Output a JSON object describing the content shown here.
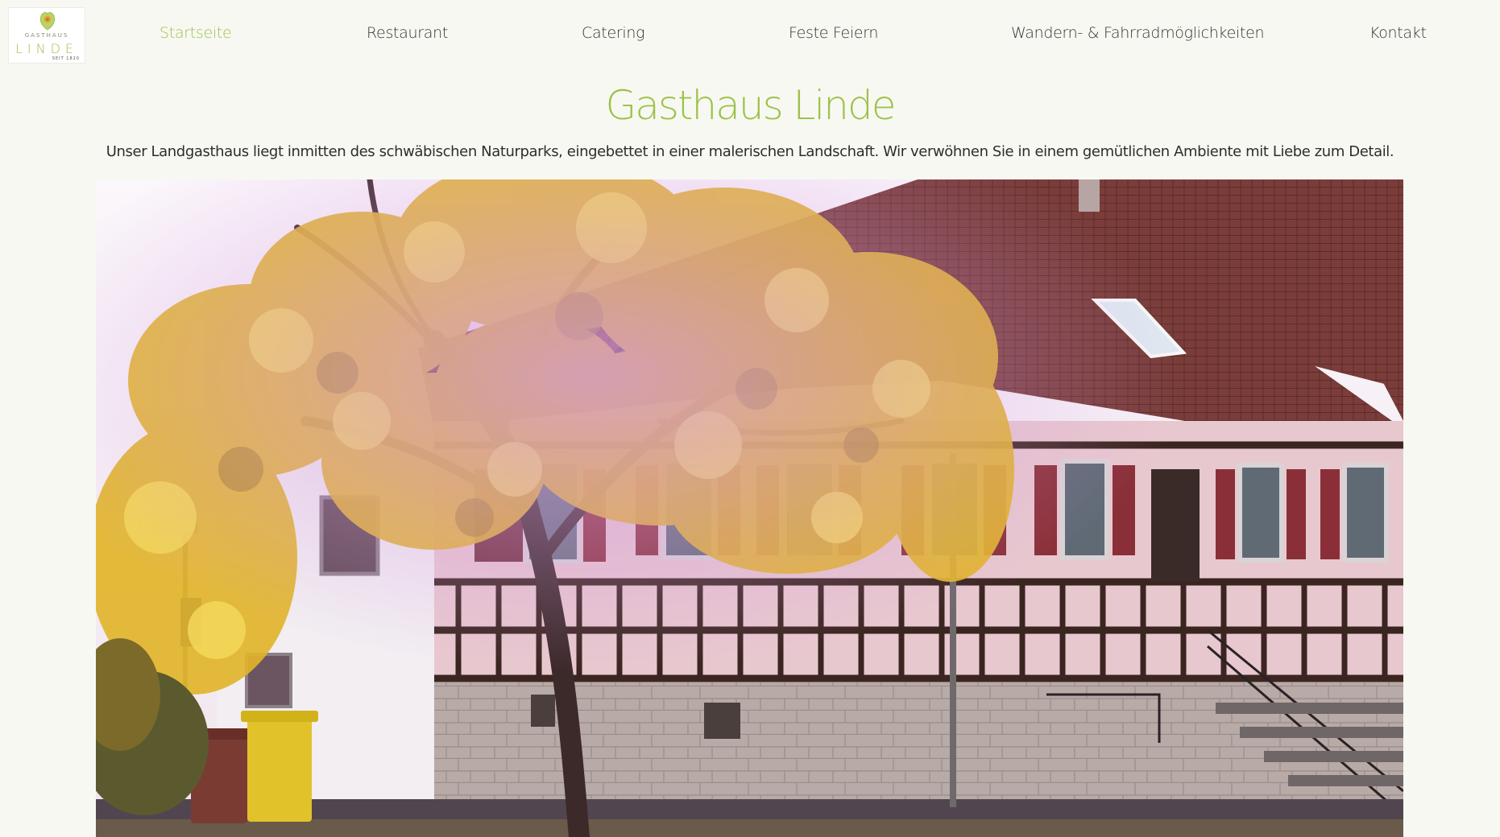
{
  "logo": {
    "top_text": "GASTHAUS",
    "main_text": "LINDE",
    "since_text": "SEIT 1820"
  },
  "nav": {
    "items": [
      {
        "label": "Startseite",
        "active": true
      },
      {
        "label": "Restaurant",
        "active": false
      },
      {
        "label": "Catering",
        "active": false
      },
      {
        "label": "Feste Feiern",
        "active": false
      },
      {
        "label": "Wandern- & Fahrradmöglichkeiten",
        "active": false
      },
      {
        "label": "Kontakt",
        "active": false
      }
    ]
  },
  "main": {
    "title": "Gasthaus Linde",
    "intro": "Unser Landgasthaus liegt inmitten des schwäbischen Naturparks, eingebettet in einer malerischen Landschaft. Wir verwöhnen Sie in einem gemütlichen Ambiente mit Liebe zum Detail."
  },
  "colors": {
    "accent": "#9cc34a",
    "background": "#f8f8f3",
    "text": "#333333"
  }
}
